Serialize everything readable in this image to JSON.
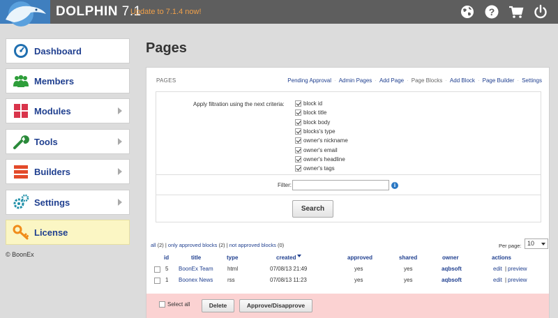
{
  "header": {
    "brand": "DOLPHIN",
    "version": "7.1",
    "update_link": "Update to 7.1.4 now!",
    "icons": [
      "globe-icon",
      "help-icon",
      "cart-icon",
      "power-icon"
    ]
  },
  "sidebar": {
    "items": [
      {
        "label": "Dashboard",
        "icon": "dashboard-icon"
      },
      {
        "label": "Members",
        "icon": "members-icon"
      },
      {
        "label": "Modules",
        "icon": "modules-icon"
      },
      {
        "label": "Tools",
        "icon": "wrench-icon"
      },
      {
        "label": "Builders",
        "icon": "builders-icon"
      },
      {
        "label": "Settings",
        "icon": "gears-icon"
      },
      {
        "label": "License",
        "icon": "key-icon"
      }
    ],
    "copyright": "© BoonEx"
  },
  "main": {
    "title": "Pages",
    "panel_heading": "PAGES",
    "tabs": [
      "Pending Approval",
      "Admin Pages",
      "Add Page",
      "Page Blocks",
      "Add Block",
      "Page Builder",
      "Settings"
    ],
    "current_tab": "Page Blocks",
    "criteria_label": "Apply filtration using the next criteria:",
    "criteria": [
      {
        "label": "block id",
        "checked": true
      },
      {
        "label": "block title",
        "checked": true
      },
      {
        "label": "block body",
        "checked": true
      },
      {
        "label": "blocks's type",
        "checked": true
      },
      {
        "label": "owner's nickname",
        "checked": true
      },
      {
        "label": "owner's email",
        "checked": true
      },
      {
        "label": "owner's headline",
        "checked": true
      },
      {
        "label": "owner's tags",
        "checked": true
      }
    ],
    "filter_label": "Filter:",
    "filter_value": "",
    "search_label": "Search",
    "filters": {
      "all": "all",
      "all_count": "2",
      "approved": "only approved blocks",
      "approved_count": "2",
      "not_approved": "not approved blocks",
      "not_approved_count": "0"
    },
    "per_page_label": "Per page:",
    "per_page_value": "10",
    "table": {
      "columns": [
        "id",
        "title",
        "type",
        "created",
        "approved",
        "shared",
        "owner",
        "actions"
      ],
      "rows": [
        {
          "id": "5",
          "title": "BoonEx Team",
          "type": "html",
          "created": "07/08/13 21:49",
          "approved": "yes",
          "shared": "yes",
          "owner": "aqbsoft",
          "edit": "edit",
          "preview": "preview"
        },
        {
          "id": "1",
          "title": "Boonex News",
          "type": "rss",
          "created": "07/08/13 11:23",
          "approved": "yes",
          "shared": "yes",
          "owner": "aqbsoft",
          "edit": "edit",
          "preview": "preview"
        }
      ]
    },
    "select_all": "Select all",
    "delete_label": "Delete",
    "approve_label": "Approve/Disapprove"
  },
  "colors": {
    "header_bg": "#5e5e5e",
    "link": "#1f3f8f",
    "update": "#f0a04a",
    "bottom_bar": "#fbd2d2",
    "license_bg": "#fbf6c4"
  }
}
